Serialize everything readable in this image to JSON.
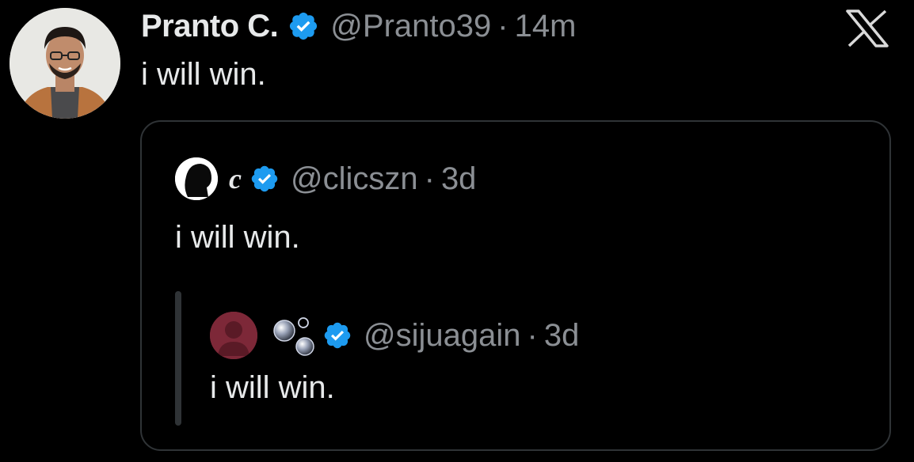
{
  "tweet": {
    "author_name": "Pranto C.",
    "handle": "@Pranto39",
    "separator": "·",
    "time": "14m",
    "text": "i will win."
  },
  "quote": {
    "author_name": "c",
    "handle": "@clicszn",
    "separator": "·",
    "time": "3d",
    "text": "i will win.",
    "nested_quote": {
      "handle": "@sijuagain",
      "separator": "·",
      "time": "3d",
      "text": "i will win."
    }
  },
  "icons": {
    "verified": "verified-badge-icon",
    "platform_logo": "x-logo-icon",
    "name_glyph": "bubbles-icon"
  },
  "colors": {
    "background": "#000000",
    "primary_text": "#e7e9ea",
    "secondary_text": "#8b8f94",
    "verified": "#1d9bf0",
    "border": "#2f3336"
  }
}
